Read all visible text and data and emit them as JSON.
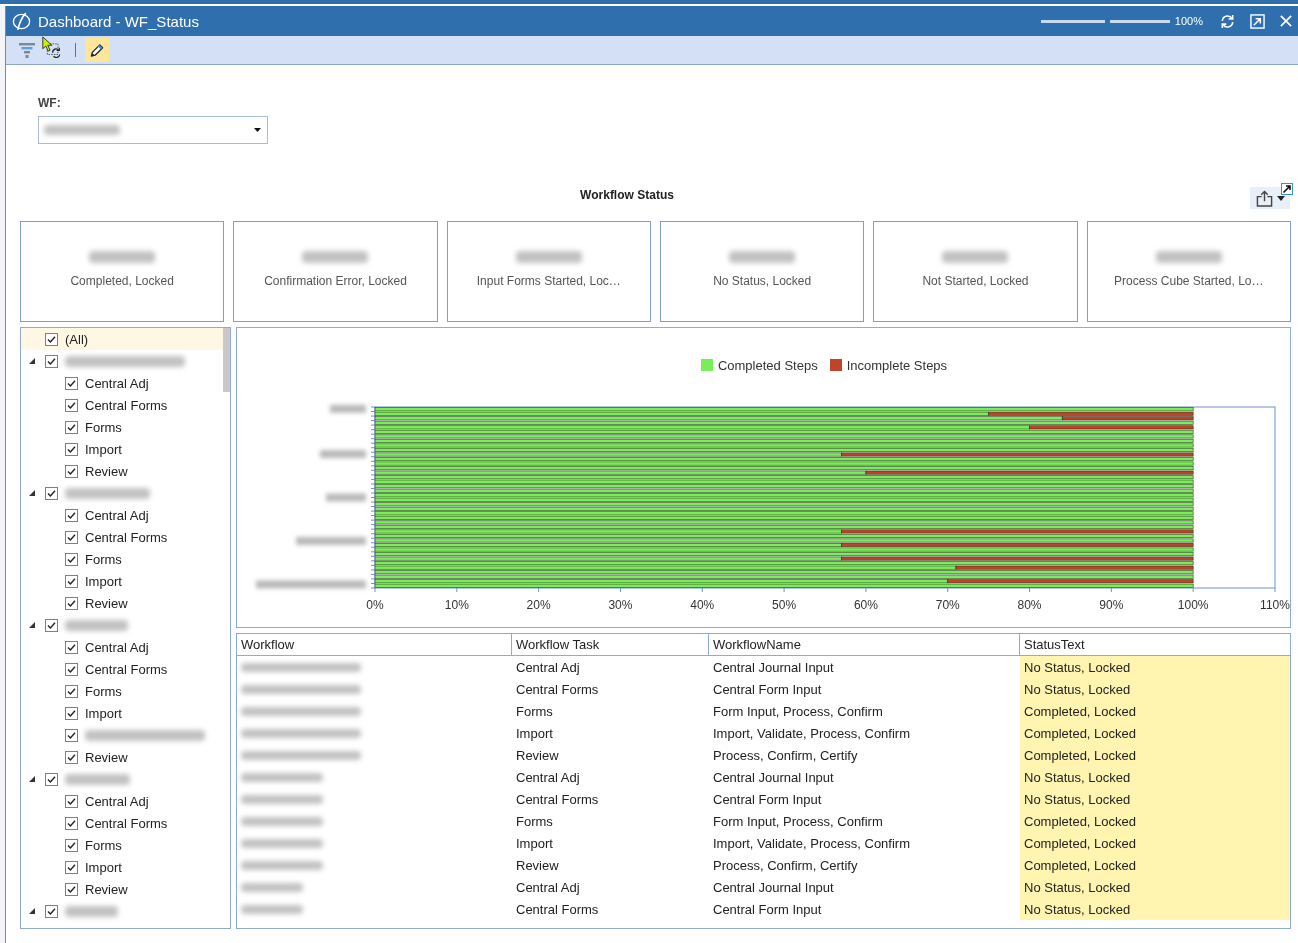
{
  "window": {
    "title": "Dashboard - WF_Status",
    "zoom": {
      "level": 0.52,
      "reading": "100%"
    }
  },
  "toolbar": {
    "buttons": [
      {
        "kind": "filter",
        "selected": false
      },
      {
        "kind": "refresh",
        "selected": false
      },
      {
        "kind": "separator"
      },
      {
        "kind": "edit",
        "selected": true
      }
    ]
  },
  "wf_filter": {
    "label": "WF:"
  },
  "panel": {
    "title": "Workflow Status"
  },
  "kpis": [
    {
      "label": "Completed, Locked"
    },
    {
      "label": "Confirmation Error, Locked"
    },
    {
      "label": "Input Forms Started, Loc…"
    },
    {
      "label": "No Status, Locked"
    },
    {
      "label": "Not Started, Locked"
    },
    {
      "label": "Process Cube Started, Lo…"
    }
  ],
  "tree": {
    "all": {
      "label": "(All)",
      "checked": true,
      "selected": true
    },
    "groups": [
      {
        "checked": true,
        "expanded": true,
        "children": [
          {
            "label": "Central Adj",
            "checked": true
          },
          {
            "label": "Central Forms",
            "checked": true
          },
          {
            "label": "Forms",
            "checked": true
          },
          {
            "label": "Import",
            "checked": true
          },
          {
            "label": "Review",
            "checked": true
          }
        ]
      },
      {
        "checked": true,
        "expanded": true,
        "children": [
          {
            "label": "Central Adj",
            "checked": true
          },
          {
            "label": "Central Forms",
            "checked": true
          },
          {
            "label": "Forms",
            "checked": true
          },
          {
            "label": "Import",
            "checked": true
          },
          {
            "label": "Review",
            "checked": true
          }
        ]
      },
      {
        "checked": true,
        "expanded": true,
        "children": [
          {
            "label": "Central Adj",
            "checked": true
          },
          {
            "label": "Central Forms",
            "checked": true
          },
          {
            "label": "Forms",
            "checked": true
          },
          {
            "label": "Import",
            "checked": true
          },
          {
            "checked": true
          },
          {
            "label": "Review",
            "checked": true
          }
        ]
      },
      {
        "checked": true,
        "expanded": true,
        "children": [
          {
            "label": "Central Adj",
            "checked": true
          },
          {
            "label": "Central Forms",
            "checked": true
          },
          {
            "label": "Forms",
            "checked": true
          },
          {
            "label": "Import",
            "checked": true
          },
          {
            "label": "Review",
            "checked": true
          }
        ]
      },
      {
        "checked": true,
        "expanded": true
      }
    ]
  },
  "chart": {
    "chart_data": {
      "type": "bar",
      "orientation": "horizontal",
      "stacked": true,
      "series": [
        {
          "name": "Completed Steps",
          "color": "#7ced5a",
          "values": [
            100,
            75,
            84,
            100,
            80,
            100,
            100,
            100,
            100,
            100,
            57,
            100,
            100,
            100,
            60,
            100,
            100,
            100,
            100,
            100,
            100,
            100,
            100,
            100,
            100,
            100,
            100,
            57,
            100,
            100,
            57,
            100,
            100,
            57,
            100,
            71,
            100,
            100,
            70,
            100
          ]
        },
        {
          "name": "Incomplete Steps",
          "color": "#c0432c",
          "values": [
            0,
            25,
            16,
            0,
            20,
            0,
            0,
            0,
            0,
            0,
            43,
            0,
            0,
            0,
            40,
            0,
            0,
            0,
            0,
            0,
            0,
            0,
            0,
            0,
            0,
            0,
            0,
            43,
            0,
            0,
            43,
            0,
            0,
            43,
            0,
            29,
            0,
            0,
            30,
            0
          ]
        }
      ],
      "xlim": [
        0,
        110
      ],
      "xticks": [
        {
          "value": 0,
          "label": "0%"
        },
        {
          "value": 10,
          "label": "10%"
        },
        {
          "value": 20,
          "label": "20%"
        },
        {
          "value": 30,
          "label": "30%"
        },
        {
          "value": 40,
          "label": "40%"
        },
        {
          "value": 50,
          "label": "50%"
        },
        {
          "value": 60,
          "label": "60%"
        },
        {
          "value": 70,
          "label": "70%"
        },
        {
          "value": 80,
          "label": "80%"
        },
        {
          "value": 90,
          "label": "90%"
        },
        {
          "value": 100,
          "label": "100%"
        },
        {
          "value": 110,
          "label": "110%"
        }
      ]
    }
  },
  "table": {
    "columns": [
      {
        "label": "Workflow",
        "highlighted": false
      },
      {
        "label": "Workflow Task",
        "highlighted": false
      },
      {
        "label": "WorkflowName",
        "highlighted": false
      },
      {
        "label": "StatusText",
        "highlighted": true
      }
    ],
    "rows": [
      {
        "task": "Central Adj",
        "name": "Central Journal Input",
        "status": "No Status, Locked"
      },
      {
        "task": "Central Forms",
        "name": "Central Form Input",
        "status": "No Status, Locked"
      },
      {
        "task": "Forms",
        "name": "Form Input, Process, Confirm",
        "status": "Completed, Locked"
      },
      {
        "task": "Import",
        "name": "Import, Validate, Process, Confirm",
        "status": "Completed, Locked"
      },
      {
        "task": "Review",
        "name": "Process, Confirm, Certify",
        "status": "Completed, Locked"
      },
      {
        "task": "Central Adj",
        "name": "Central Journal Input",
        "status": "No Status, Locked"
      },
      {
        "task": "Central Forms",
        "name": "Central Form Input",
        "status": "No Status, Locked"
      },
      {
        "task": "Forms",
        "name": "Form Input, Process, Confirm",
        "status": "Completed, Locked"
      },
      {
        "task": "Import",
        "name": "Import, Validate, Process, Confirm",
        "status": "Completed, Locked"
      },
      {
        "task": "Review",
        "name": "Process, Confirm, Certify",
        "status": "Completed, Locked"
      },
      {
        "task": "Central Adj",
        "name": "Central Journal Input",
        "status": "No Status, Locked"
      },
      {
        "task": "Central Forms",
        "name": "Central Form Input",
        "status": "No Status, Locked"
      }
    ]
  }
}
